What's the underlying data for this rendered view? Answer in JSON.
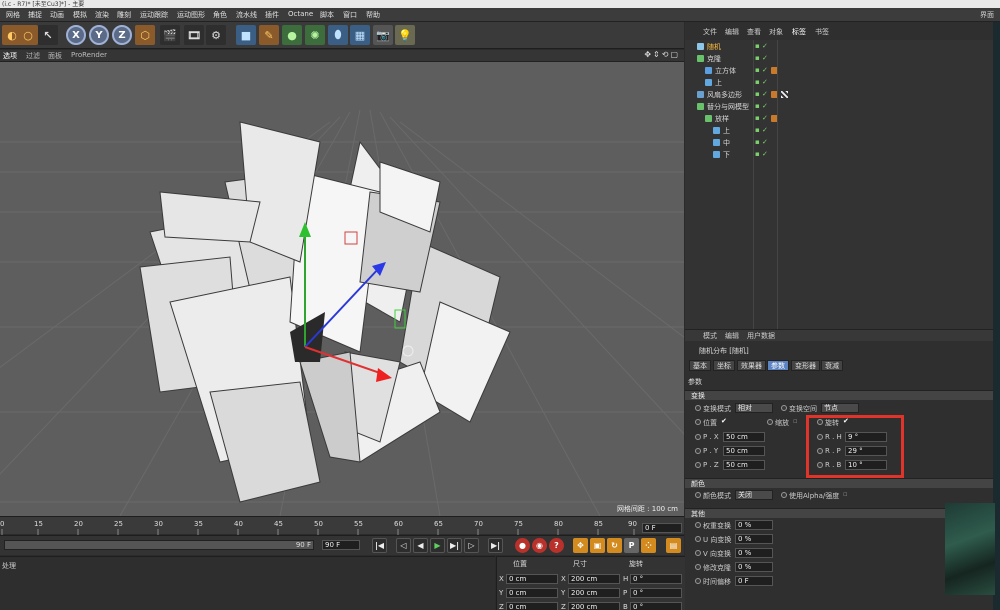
{
  "titlebar": {
    "left": "(i.c - R7)* [未至Cu3]*] - 主要",
    "right": "界面"
  },
  "menubar": {
    "items": [
      "网格",
      "捕捉",
      "动画",
      "模拟",
      "渲染",
      "雕刻",
      "运动跟踪",
      "运动图形",
      "角色",
      "流水线",
      "插件",
      "Octane",
      "脚本",
      "窗口",
      "帮助"
    ],
    "right": "界面"
  },
  "viewport_header": {
    "items": [
      "选项",
      "过滤",
      "面板",
      "ProRender"
    ]
  },
  "viewport": {
    "grid_label": "网格间距 : 100 cm"
  },
  "object_manager": {
    "tabs": [
      "文件",
      "编辑",
      "查看",
      "对象",
      "标签",
      "书签"
    ],
    "objects": [
      {
        "name": "随机",
        "indent": 0,
        "selected": true,
        "color": "#8fc7e8"
      },
      {
        "name": "克隆",
        "indent": 0,
        "selected": false,
        "color": "#69c16b"
      },
      {
        "name": "立方体",
        "indent": 1,
        "selected": false,
        "color": "#5b9fe0"
      },
      {
        "name": "上",
        "indent": 1,
        "selected": false,
        "color": "#62a8e0"
      },
      {
        "name": "风扇多边形",
        "indent": 0,
        "selected": false,
        "color": "#6aa0d0"
      },
      {
        "name": "替分与网模型",
        "indent": 0,
        "selected": false,
        "color": "#69c16b"
      },
      {
        "name": "放样",
        "indent": 1,
        "selected": false,
        "color": "#69c16b"
      },
      {
        "name": "上",
        "indent": 2,
        "selected": false,
        "color": "#62a8e0"
      },
      {
        "name": "中",
        "indent": 2,
        "selected": false,
        "color": "#62a8e0"
      },
      {
        "name": "下",
        "indent": 2,
        "selected": false,
        "color": "#62a8e0"
      }
    ]
  },
  "attribute_manager": {
    "header": [
      "模式",
      "编辑",
      "用户数据"
    ],
    "title": "随机分布 [随机]",
    "tabs": [
      "基本",
      "坐标",
      "效果器",
      "参数",
      "变形器",
      "衰减"
    ],
    "active_tab": "参数",
    "params_label": "参数",
    "transform": {
      "section": "变换",
      "mode_label": "变换模式",
      "mode_value": "相对",
      "space_label": "变换空间",
      "space_value": "节点",
      "position_label": "位置",
      "scale_label": "缩放",
      "rotation_label": "旋转",
      "p_labels": [
        "P . X",
        "P . Y",
        "P . Z"
      ],
      "p_values": [
        "50 cm",
        "50 cm",
        "50 cm"
      ],
      "r_labels": [
        "R . H",
        "R . P",
        "R . B"
      ],
      "r_values": [
        "9 °",
        "29 °",
        "10 °"
      ]
    },
    "color": {
      "section": "颜色",
      "mode_label": "颜色模式",
      "mode_value": "关闭",
      "alpha_label": "使用Alpha/强度"
    },
    "other": {
      "section": "其他",
      "rows": [
        {
          "label": "权重变换",
          "value": "0 %"
        },
        {
          "label": "U 向变换",
          "value": "0 %"
        },
        {
          "label": "V 向变换",
          "value": "0 %"
        },
        {
          "label": "修改克隆",
          "value": "0 %"
        },
        {
          "label": "时间偏移",
          "value": "0 F"
        }
      ]
    }
  },
  "timeline": {
    "ticks": [
      "0",
      "15",
      "20",
      "25",
      "30",
      "35",
      "40",
      "45",
      "50",
      "55",
      "60",
      "65",
      "70",
      "75",
      "80",
      "85",
      "90"
    ],
    "current_frame": "0 F"
  },
  "playbar": {
    "range_end": "90 F",
    "end_frame": "90 F"
  },
  "bottom": {
    "left_label": "处理",
    "coord_headers": [
      "位置",
      "尺寸",
      "旋转"
    ],
    "rows": [
      {
        "axis": "X",
        "pos": "0 cm",
        "size_axis": "X",
        "size": "200 cm",
        "rot_axis": "H",
        "rot": "0 °"
      },
      {
        "axis": "Y",
        "pos": "0 cm",
        "size_axis": "Y",
        "size": "200 cm",
        "rot_axis": "P",
        "rot": "0 °"
      },
      {
        "axis": "Z",
        "pos": "0 cm",
        "size_axis": "Z",
        "size": "200 cm",
        "rot_axis": "B",
        "rot": "0 °"
      }
    ]
  }
}
